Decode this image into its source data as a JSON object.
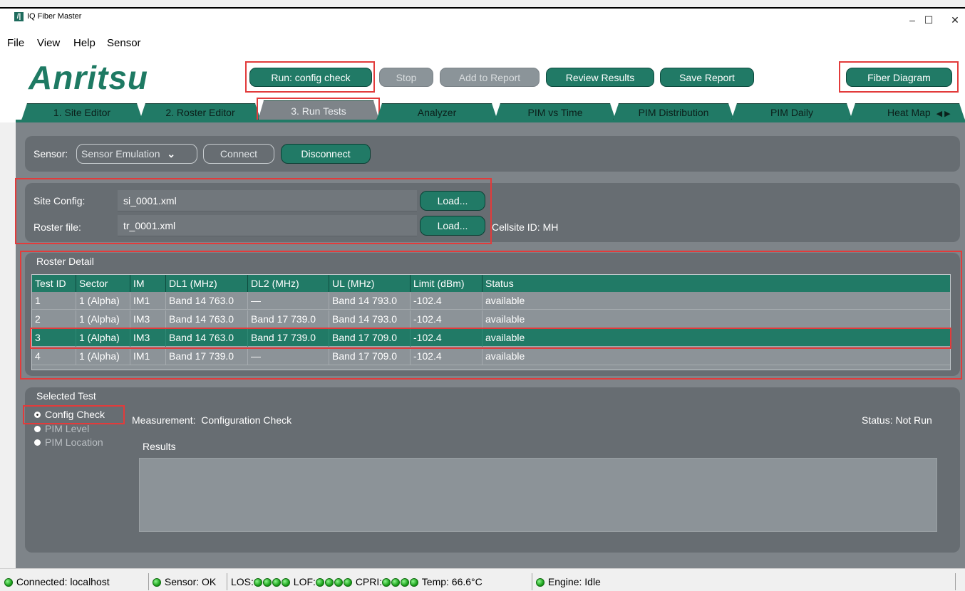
{
  "window": {
    "title": "IQ Fiber Master",
    "icon_glyph": "/|",
    "minimize": "–",
    "maximize": "☐",
    "close": "✕"
  },
  "menu": [
    "File",
    "View",
    "Help",
    "Sensor"
  ],
  "logo": "Anritsu",
  "toolbar": {
    "run_label": "Run: config check",
    "stop_label": "Stop",
    "add_report_label": "Add to Report",
    "review_label": "Review Results",
    "save_report_label": "Save Report",
    "fiber_diagram_label": "Fiber Diagram"
  },
  "tabs": [
    {
      "label": "1. Site Editor"
    },
    {
      "label": "2. Roster Editor"
    },
    {
      "label": "3. Run Tests"
    },
    {
      "label": "Analyzer"
    },
    {
      "label": "PIM vs Time"
    },
    {
      "label": "PIM Distribution"
    },
    {
      "label": "PIM Daily"
    },
    {
      "label": "Heat Map"
    }
  ],
  "tab_scroll": "◀ ▶",
  "sensor": {
    "label": "Sensor:",
    "value": "Sensor Emulation",
    "dropdown_glyph": "⌄",
    "connect_label": "Connect",
    "disconnect_label": "Disconnect"
  },
  "config": {
    "site_label": "Site Config:",
    "site_value": "si_0001.xml",
    "roster_label": "Roster file:",
    "roster_value": "tr_0001.xml",
    "load_label": "Load...",
    "cellsite": "Cellsite ID: MH"
  },
  "roster": {
    "title": "Roster Detail",
    "columns": [
      "Test ID",
      "Sector",
      "IM",
      "DL1 (MHz)",
      "DL2 (MHz)",
      "UL (MHz)",
      "Limit (dBm)",
      "Status"
    ],
    "rows": [
      [
        "1",
        "1 (Alpha)",
        "IM1",
        "Band 14 763.0",
        "—",
        "Band 14 793.0",
        "-102.4",
        "available"
      ],
      [
        "2",
        "1 (Alpha)",
        "IM3",
        "Band 14 763.0",
        "Band 17 739.0",
        "Band 14 793.0",
        "-102.4",
        "available"
      ],
      [
        "3",
        "1 (Alpha)",
        "IM3",
        "Band 14 763.0",
        "Band 17 739.0",
        "Band 17 709.0",
        "-102.4",
        "available"
      ],
      [
        "4",
        "1 (Alpha)",
        "IM1",
        "Band 17 739.0",
        "—",
        "Band 17 709.0",
        "-102.4",
        "available"
      ]
    ],
    "selected_row": 3
  },
  "selected_test": {
    "title": "Selected Test",
    "options": [
      "Config Check",
      "PIM Level",
      "PIM Location"
    ],
    "selected": "Config Check",
    "measurement": "Measurement:  Configuration Check",
    "status": "Status: Not Run",
    "results_label": "Results"
  },
  "statusbar": {
    "connected": "Connected: localhost",
    "sensor": "Sensor: OK",
    "los": "LOS:",
    "lof": "LOF:",
    "cpri": "CPRI:",
    "temp": "Temp: 66.6°C",
    "engine": "Engine: Idle"
  },
  "colors": {
    "accent": "#217a66",
    "panel": "#676d72",
    "background": "#7e8489",
    "highlight": "#e23b3b",
    "led": "#1fa51f"
  }
}
